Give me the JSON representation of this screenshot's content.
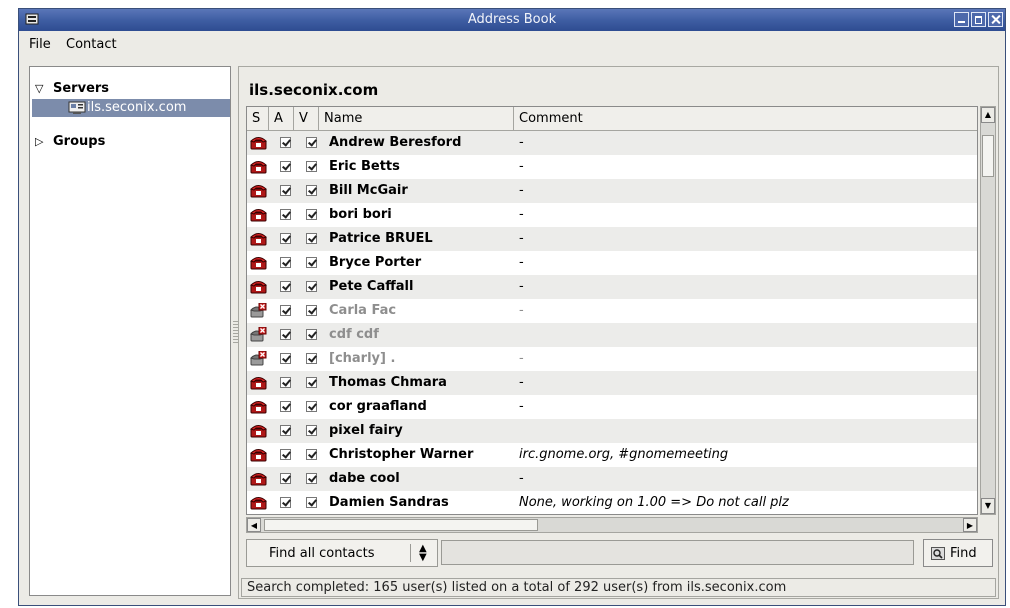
{
  "window": {
    "title": "Address Book"
  },
  "menu": {
    "file": "File",
    "contact": "Contact"
  },
  "tree": {
    "servers_label": "Servers",
    "server_item": "ils.seconix.com",
    "groups_label": "Groups"
  },
  "main": {
    "server_title": "ils.seconix.com",
    "columns": {
      "s": "S",
      "a": "A",
      "v": "V",
      "name": "Name",
      "comment": "Comment"
    },
    "rows": [
      {
        "name": "Andrew Beresford",
        "comment": "-",
        "online": true
      },
      {
        "name": "Eric Betts",
        "comment": "-",
        "online": true
      },
      {
        "name": "Bill McGair",
        "comment": "-",
        "online": true
      },
      {
        "name": "bori bori",
        "comment": "-",
        "online": true
      },
      {
        "name": "Patrice BRUEL",
        "comment": "-",
        "online": true
      },
      {
        "name": "Bryce Porter",
        "comment": "-",
        "online": true
      },
      {
        "name": "Pete Caffall",
        "comment": "-",
        "online": true
      },
      {
        "name": "Carla Fac",
        "comment": "-",
        "online": false
      },
      {
        "name": "cdf cdf",
        "comment": "",
        "online": false
      },
      {
        "name": "[charly] .",
        "comment": "-",
        "online": false
      },
      {
        "name": "Thomas Chmara",
        "comment": "-",
        "online": true
      },
      {
        "name": "cor graafland",
        "comment": "-",
        "online": true
      },
      {
        "name": "pixel fairy",
        "comment": "",
        "online": true
      },
      {
        "name": "Christopher Warner",
        "comment": "irc.gnome.org, #gnomemeeting",
        "online": true
      },
      {
        "name": "dabe cool",
        "comment": "-",
        "online": true
      },
      {
        "name": "Damien Sandras",
        "comment": "None, working on 1.00 => Do not call plz",
        "online": true
      }
    ]
  },
  "find": {
    "filter_selected": "Find all contacts",
    "search_value": "",
    "find_button": "Find"
  },
  "status": "Search completed: 165 user(s) listed on a total of 292 user(s) from ils.seconix.com",
  "colors": {
    "titlebar": "#3f5ea3",
    "selection": "#7c8cab",
    "phone_online": "#b01818"
  },
  "icons": {
    "online": "phone-icon",
    "offline": "phone-offline-icon"
  }
}
